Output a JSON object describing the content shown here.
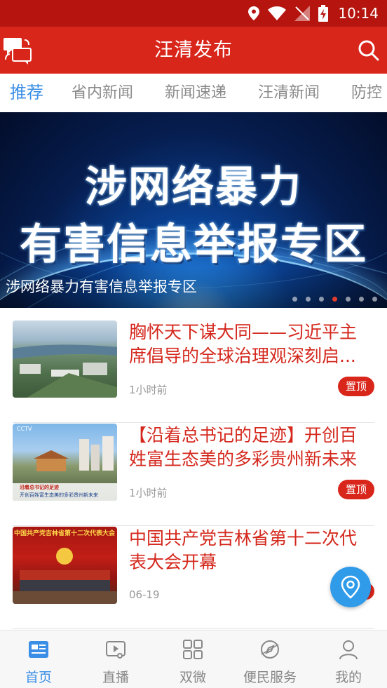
{
  "status_bar": {
    "time": "10:14"
  },
  "header": {
    "title": "汪清发布",
    "translate_badge_top": "中文",
    "translate_badge_bottom": "朝文"
  },
  "tabs": [
    {
      "label": "推荐",
      "active": true
    },
    {
      "label": "省内新闻"
    },
    {
      "label": "新闻速递"
    },
    {
      "label": "汪清新闻"
    },
    {
      "label": "防控"
    }
  ],
  "banner": {
    "headline_line1": "涉网络暴力",
    "headline_line2": "有害信息举报专区",
    "caption": "涉网络暴力有害信息举报专区",
    "slide_count": 7,
    "active_slide": 4
  },
  "news": [
    {
      "title": "胸怀天下谋大同——习近平主席倡导的全球治理观深刻启...",
      "time": "1小时前",
      "badge": "置顶"
    },
    {
      "title": "【沿着总书记的足迹】开创百姓富生态美的多彩贵州新未来",
      "time": "1小时前",
      "badge": "置顶",
      "thumb_caption_1": "沿着总书记的足迹",
      "thumb_caption_2": "开创百姓富生态美的多彩贵州新未来",
      "thumb_logo": "CCTV"
    },
    {
      "title": "中国共产党吉林省第十二次代表大会开幕",
      "time": "06-19",
      "thumb_banner": "中国共产党吉林省第十二次代表大会"
    }
  ],
  "bottom_nav": [
    {
      "label": "首页",
      "icon": "home-news-icon",
      "active": true
    },
    {
      "label": "直播",
      "icon": "live-video-icon"
    },
    {
      "label": "双微",
      "icon": "grid-apps-icon"
    },
    {
      "label": "便民服务",
      "icon": "compass-icon"
    },
    {
      "label": "我的",
      "icon": "user-icon"
    }
  ],
  "colors": {
    "brand_red": "#d9261b",
    "status_red": "#b5140f",
    "accent_blue": "#3a8ee6"
  }
}
